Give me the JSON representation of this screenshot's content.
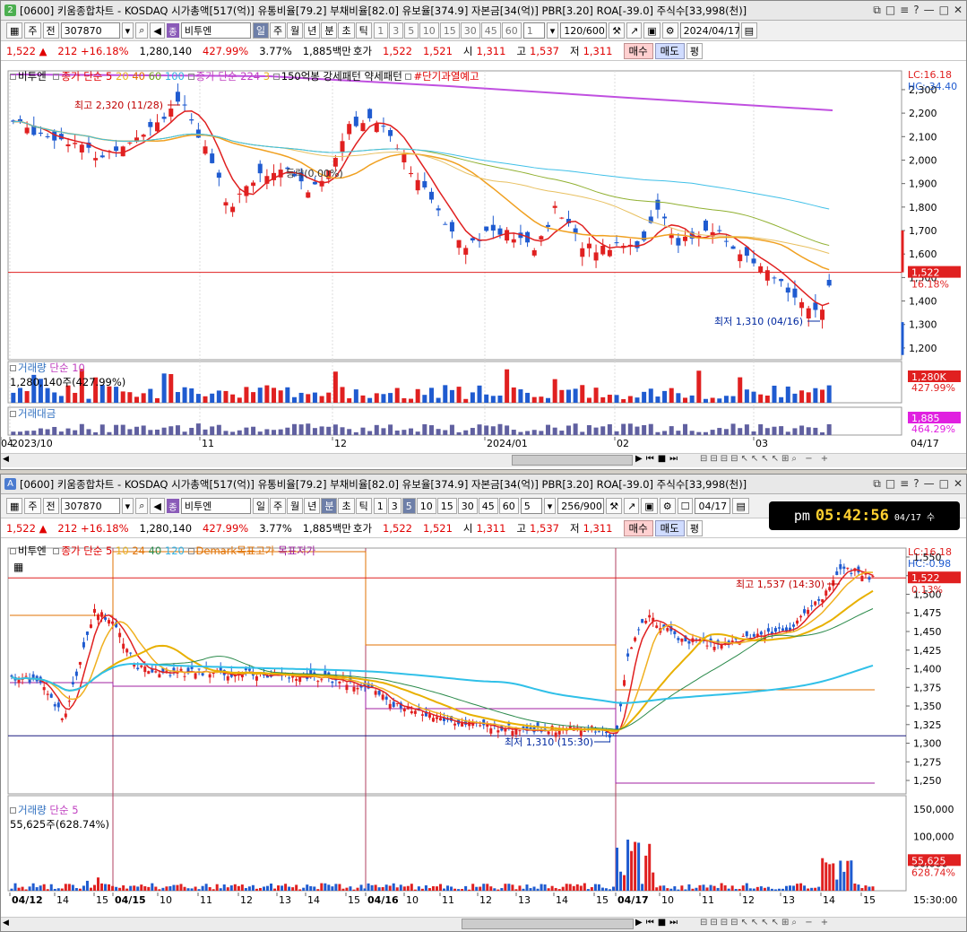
{
  "top": {
    "badge": "2",
    "title": "[0600] 키움종합차트 - KOSDAQ 시가총액[517(억)] 유통비율[79.2] 부채비율[82.0] 유보율[374.9] 자본금[34(억)] PBR[3.20] ROA[-39.0] 주식수[33,998(천)]",
    "toolbar": {
      "type": "주",
      "mode": "전",
      "code": "307870",
      "name": "비투엔",
      "periods": [
        "일",
        "주",
        "월",
        "년",
        "분",
        "초",
        "틱"
      ],
      "active_period": "일",
      "nums": [
        "1",
        "3",
        "5",
        "10",
        "15",
        "30",
        "45",
        "60"
      ],
      "num_sel": "1",
      "count": "120/600",
      "date": "2024/04/17",
      "icon_gear": "gear-icon"
    },
    "quote": {
      "price": "1,522 ▲",
      "change": "212 +16.18%",
      "volume": "1,280,140",
      "vol_pct": "427.99%",
      "turnover": "3.77%",
      "amount": "1,885백만",
      "hoga_label": "호가",
      "ask": "1,522",
      "bid": "1,521",
      "open_label": "시",
      "open": "1,311",
      "high_label": "고",
      "high": "1,537",
      "low_label": "저",
      "low": "1,311",
      "buy": "매수",
      "sell": "매도",
      "pyeong": "평"
    },
    "legend": {
      "name": "비투엔",
      "ma": "종가 단순 5",
      "p20": "20",
      "p40": "40",
      "p60": "60",
      "p100": "100",
      "ma2": "종가 단순 224",
      "p3": "3",
      "pattern": "150억봉 강세패턴 약세패턴",
      "warn": "#단기과열예고"
    },
    "annot": {
      "high": "최고 2,320 (11/28)",
      "low": "최저 1,310 (04/16)",
      "mid": "등락(0.00%)"
    },
    "right": {
      "lc": "LC:16.18",
      "hc": "HC:-34.40",
      "price_tag": "1,522",
      "pct_tag": "16.18%",
      "vol_tag": "1,280K",
      "vol_pct": "427.99%",
      "amt_tag": "1,885",
      "amt_pct": "464.29%"
    },
    "yaxis": [
      "2,300",
      "2,200",
      "2,100",
      "2,000",
      "1,900",
      "1,800",
      "1,700",
      "1,600",
      "1,500",
      "1,400",
      "1,300",
      "1,200"
    ],
    "vol": {
      "label": "거래량",
      "ma": "단순 10",
      "value": "1,280,140주(427.99%)"
    },
    "amt": {
      "label": "거래대금"
    },
    "xaxis": [
      "2023/10",
      "11",
      "12",
      "2024/01",
      "02",
      "03",
      "04"
    ],
    "xaxis_end": "04/17"
  },
  "bottom": {
    "badge": "A",
    "title": "[0600] 키움종합차트 - KOSDAQ 시가총액[517(억)] 유통비율[79.2] 부채비율[82.0] 유보율[374.9] 자본금[34(억)] PBR[3.20] ROA[-39.0] 주식수[33,998(천)]",
    "toolbar": {
      "type": "주",
      "mode": "전",
      "code": "307870",
      "name": "비투엔",
      "periods": [
        "일",
        "주",
        "월",
        "년",
        "분",
        "초",
        "틱"
      ],
      "active_period": "분",
      "nums": [
        "1",
        "3",
        "5",
        "10",
        "15",
        "30",
        "45",
        "60"
      ],
      "active_num": "5",
      "num_sel": "5",
      "count": "256/900",
      "date": "04/17"
    },
    "quote": {
      "price": "1,522 ▲",
      "change": "212 +16.18%",
      "volume": "1,280,140",
      "vol_pct": "427.99%",
      "turnover": "3.77%",
      "amount": "1,885백만",
      "hoga_label": "호가",
      "ask": "1,522",
      "bid": "1,521",
      "open_label": "시",
      "open": "1,311",
      "high_label": "고",
      "high": "1,537",
      "low_label": "저",
      "low": "1,311",
      "buy": "매수",
      "sell": "매도",
      "pyeong": "평"
    },
    "clock": {
      "ampm": "pm",
      "time": "05:42:56",
      "date": "04/17 수"
    },
    "legend": {
      "name": "비투엔",
      "ma": "종가 단순 5",
      "p10": "10",
      "p24": "24",
      "p40": "40",
      "p120": "120",
      "demark": "Demark목표고가",
      "target_low": "목표저가"
    },
    "annot": {
      "high": "최고 1,537 (14:30)",
      "low": "최저 1,310 (15:30)"
    },
    "right": {
      "lc": "LC:16.18",
      "hc": "HC:-0.98",
      "price_tag": "1,522",
      "pct_tag": "0.13%",
      "vol_tag": "55,625",
      "vol_pct": "628.74%"
    },
    "yaxis": [
      "1,550",
      "1,525",
      "1,500",
      "1,475",
      "1,450",
      "1,425",
      "1,400",
      "1,375",
      "1,350",
      "1,325",
      "1,300",
      "1,275",
      "1,250"
    ],
    "vol": {
      "label": "거래량",
      "ma": "단순 5",
      "value": "55,625주(628.74%)",
      "ticks": [
        "150,000",
        "100,000",
        "50,000"
      ]
    },
    "xaxis": [
      "04/12",
      "14",
      "15",
      "04/15",
      "10",
      "11",
      "12",
      "13",
      "14",
      "15",
      "04/16",
      "10",
      "11",
      "12",
      "13",
      "14",
      "15",
      "04/17",
      "10",
      "11",
      "12",
      "13",
      "14",
      "15"
    ],
    "xaxis_end": "15:30:00"
  }
}
